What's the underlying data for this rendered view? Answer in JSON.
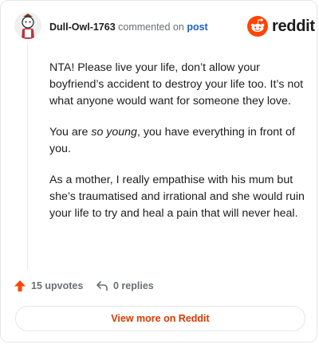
{
  "header": {
    "username": "Dull-Owl-1763",
    "commented_text": "commented on",
    "post_link": "post",
    "brand": "reddit"
  },
  "comment": {
    "p1": "NTA! Please live your life, don’t allow your boyfriend’s accident to destroy your life too. It’s not what anyone would want for someone they love.",
    "p2_before": "You are ",
    "p2_em": "so young",
    "p2_after": ", you have everything in front of you.",
    "p3": "As a mother, I really empathise with his mum but she’s traumatised and irrational and she would ruin your life to try and heal a pain that will never heal."
  },
  "actions": {
    "upvotes": "15 upvotes",
    "replies": "0 replies"
  },
  "footer": {
    "view_more": "View more on Reddit"
  },
  "colors": {
    "brand_orange": "#ff4500",
    "link_blue": "#1c5fc7",
    "view_more_text": "#d93a00"
  }
}
